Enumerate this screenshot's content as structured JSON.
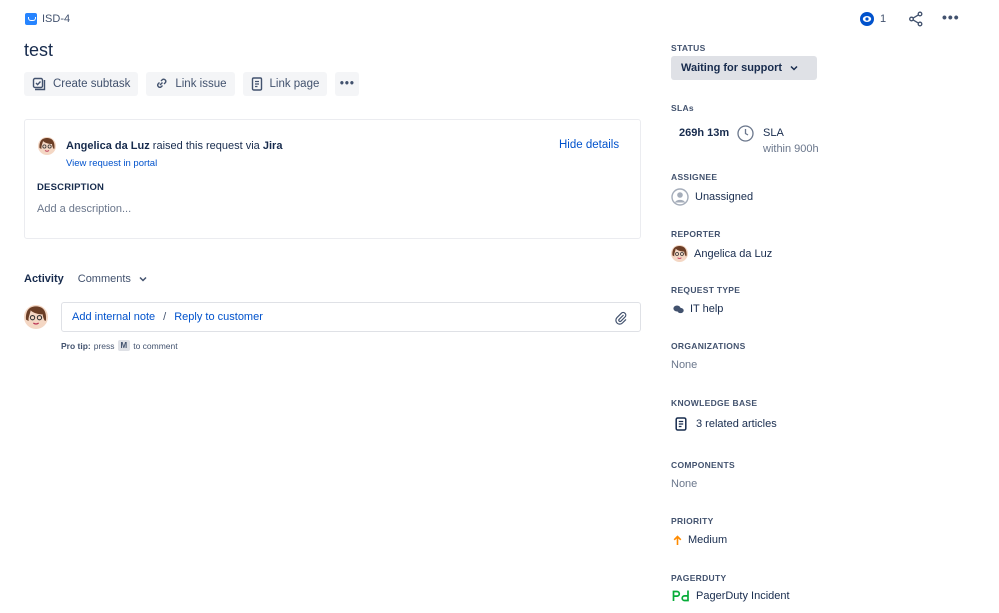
{
  "issue": {
    "key": "ISD-4",
    "title": "test"
  },
  "actions": {
    "create_subtask": "Create subtask",
    "link_issue": "Link issue",
    "link_page": "Link page",
    "more": "•••"
  },
  "request": {
    "reporter_name": "Angelica da Luz",
    "raised_text": " raised this request via ",
    "channel": "Jira",
    "view_portal": "View request in portal",
    "hide_details": "Hide details",
    "description_label": "DESCRIPTION",
    "description_placeholder": "Add a description..."
  },
  "activity": {
    "label": "Activity",
    "filter": "Comments",
    "add_note": "Add internal note",
    "separator": "/",
    "reply": "Reply to customer",
    "protip_label": "Pro tip:",
    "protip_press": "press",
    "protip_key": "M",
    "protip_rest": "to comment"
  },
  "topbar": {
    "watch_count": "1",
    "more": "•••"
  },
  "sidebar": {
    "status_label": "STATUS",
    "status_value": "Waiting for support",
    "slas_label": "SLAs",
    "sla_time": "269h 13m",
    "sla_name": "SLA",
    "sla_within": "within 900h",
    "assignee_label": "ASSIGNEE",
    "assignee_value": "Unassigned",
    "reporter_label": "REPORTER",
    "reporter_value": "Angelica da Luz",
    "request_type_label": "REQUEST TYPE",
    "request_type_value": "IT help",
    "organizations_label": "ORGANIZATIONS",
    "organizations_value": "None",
    "kb_label": "KNOWLEDGE BASE",
    "kb_value": "3 related articles",
    "components_label": "COMPONENTS",
    "components_value": "None",
    "priority_label": "PRIORITY",
    "priority_value": "Medium",
    "pagerduty_label": "PAGERDUTY",
    "pagerduty_value": "PagerDuty Incident"
  },
  "colors": {
    "link": "#0052CC",
    "issue_type": "#2684FF",
    "priority": "#FF8B00",
    "pagerduty": "#06AC38",
    "status_bg": "#DFE1E6"
  }
}
